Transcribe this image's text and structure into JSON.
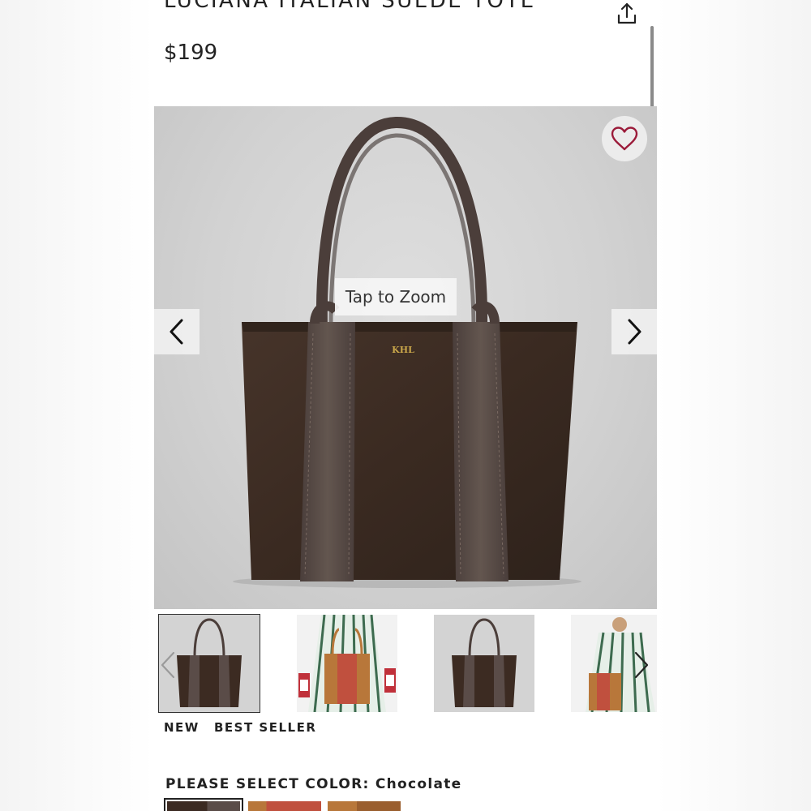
{
  "product": {
    "title": "LUCIANA ITALIAN SUEDE TOTE",
    "price": "$199",
    "monogram": "KHL"
  },
  "gallery": {
    "zoom_hint": "Tap to Zoom",
    "thumbnails": [
      {
        "label": "Chocolate tote",
        "selected": true
      },
      {
        "label": "Model holding red and tan tote"
      },
      {
        "label": "Chocolate tote"
      },
      {
        "label": "Model wearing striped dress with tote"
      }
    ]
  },
  "badges": [
    "NEW",
    "BEST SELLER"
  ],
  "color_select": {
    "label": "PLEASE SELECT COLOR:",
    "selected": "Chocolate",
    "swatches": [
      {
        "name": "Chocolate",
        "color": "#3b2a22"
      },
      {
        "name": "Red",
        "color": "#c0503e"
      },
      {
        "name": "Tan",
        "color": "#b8773a"
      }
    ]
  },
  "icons": {
    "share": "share-icon",
    "favorite": "heart-icon",
    "prev": "chevron-left-icon",
    "next": "chevron-right-icon"
  },
  "colors": {
    "heart": "#9b1b3a",
    "suede": "#3c2b22",
    "leather": "#5a4c48"
  }
}
